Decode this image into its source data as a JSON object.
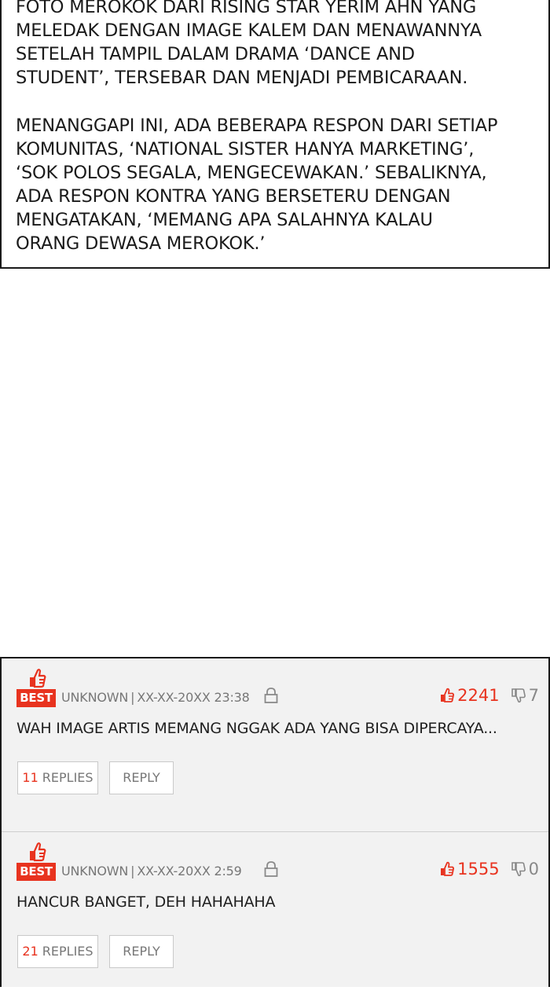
{
  "caption": {
    "paragraphs": [
      [
        "FOTO MEROKOK DARI RISING STAR YERIM AHN YANG",
        "MELEDAK DENGAN IMAGE KALEM DAN MENAWANNYA",
        "SETELAH TAMPIL DALAM DRAMA ‘DANCE AND",
        "STUDENT’, TERSEBAR DAN MENJADI PEMBICARAAN."
      ],
      [
        "MENANGGAPI INI, ADA BEBERAPA RESPON DARI SETIAP",
        "KOMUNITAS, ‘NATIONAL SISTER HANYA MARKETING’,",
        "‘SOK POLOS SEGALA, MENGECEWAKAN.’ SEBALIKNYA,",
        "ADA RESPON KONTRA YANG BERSETERU DENGAN",
        "MENGATAKAN, ‘MEMANG APA SALAHNYA KALAU",
        "ORANG DEWASA MEROKOK.’"
      ]
    ]
  },
  "comments": [
    {
      "badge": "BEST",
      "author": "UNKNOWN",
      "separator": "|",
      "timestamp": "XX-XX-20XX 23:38",
      "likes": "2241",
      "dislikes": "7",
      "text": "WAH IMAGE ARTIS MEMANG NGGAK ADA YANG BISA DIPERCAYA...",
      "reply_count": "11",
      "replies_label": "REPLIES",
      "reply_label": "REPLY"
    },
    {
      "badge": "BEST",
      "author": "UNKNOWN",
      "separator": "|",
      "timestamp": "XX-XX-20XX 2:59",
      "likes": "1555",
      "dislikes": "0",
      "text": "HANCUR BANGET, DEH HAHAHAHA",
      "reply_count": "21",
      "replies_label": "REPLIES",
      "reply_label": "REPLY"
    }
  ],
  "colors": {
    "accent_red": "#e8331f",
    "meta_gray": "#777777",
    "panel_bg": "#f2f2f2"
  },
  "icons": {
    "badge": "thumbs-up-icon",
    "lock": "lock-icon",
    "like": "thumbs-up-icon",
    "dislike": "thumbs-down-icon"
  }
}
